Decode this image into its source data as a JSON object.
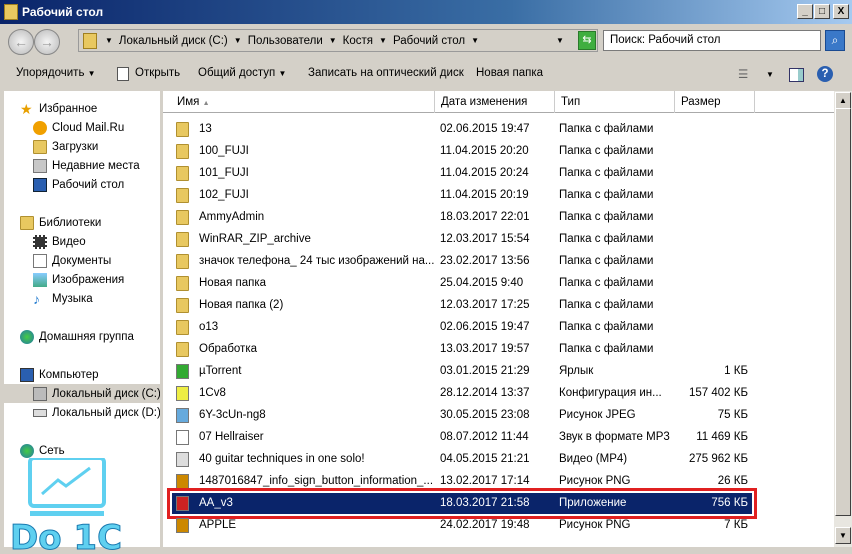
{
  "window": {
    "title": "Рабочий стол",
    "minimize": "_",
    "maximize": "□",
    "close": "X"
  },
  "address": {
    "crumbs": [
      "Локальный диск (C:)",
      "Пользователи",
      "Костя",
      "Рабочий стол"
    ],
    "search_placeholder": "Поиск: Рабочий стол"
  },
  "toolbar": {
    "organize": "Упорядочить",
    "open": "Открыть",
    "share": "Общий доступ",
    "burn": "Записать на оптический диск",
    "new_folder": "Новая папка"
  },
  "sidebar": {
    "favorites": "Избранное",
    "fav_items": [
      "Cloud Mail.Ru",
      "Загрузки",
      "Недавние места",
      "Рабочий стол"
    ],
    "libraries": "Библиотеки",
    "lib_items": [
      "Видео",
      "Документы",
      "Изображения",
      "Музыка"
    ],
    "homegroup": "Домашняя группа",
    "computer": "Компьютер",
    "comp_items": [
      "Локальный диск (C:)",
      "Локальный диск (D:)"
    ],
    "network": "Сеть"
  },
  "columns": {
    "name": "Имя",
    "date": "Дата изменения",
    "type": "Тип",
    "size": "Размер"
  },
  "files": [
    {
      "name": "13",
      "date": "02.06.2015 19:47",
      "type": "Папка с файлами",
      "size": "",
      "icon": "folder"
    },
    {
      "name": "100_FUJI",
      "date": "11.04.2015 20:20",
      "type": "Папка с файлами",
      "size": "",
      "icon": "folder"
    },
    {
      "name": "101_FUJI",
      "date": "11.04.2015 20:24",
      "type": "Папка с файлами",
      "size": "",
      "icon": "folder"
    },
    {
      "name": "102_FUJI",
      "date": "11.04.2015 20:19",
      "type": "Папка с файлами",
      "size": "",
      "icon": "folder"
    },
    {
      "name": "AmmyAdmin",
      "date": "18.03.2017 22:01",
      "type": "Папка с файлами",
      "size": "",
      "icon": "folder"
    },
    {
      "name": "WinRAR_ZIP_archive",
      "date": "12.03.2017 15:54",
      "type": "Папка с файлами",
      "size": "",
      "icon": "folder"
    },
    {
      "name": "значок телефона_ 24 тыс изображений на...",
      "date": "23.02.2017 13:56",
      "type": "Папка с файлами",
      "size": "",
      "icon": "folder"
    },
    {
      "name": "Новая папка",
      "date": "25.04.2015 9:40",
      "type": "Папка с файлами",
      "size": "",
      "icon": "folder"
    },
    {
      "name": "Новая папка (2)",
      "date": "12.03.2017 17:25",
      "type": "Папка с файлами",
      "size": "",
      "icon": "folder"
    },
    {
      "name": "o13",
      "date": "02.06.2015 19:47",
      "type": "Папка с файлами",
      "size": "",
      "icon": "folder"
    },
    {
      "name": "Обработка",
      "date": "13.03.2017 19:57",
      "type": "Папка с файлами",
      "size": "",
      "icon": "folder"
    },
    {
      "name": "µTorrent",
      "date": "03.01.2015 21:29",
      "type": "Ярлык",
      "size": "1 КБ",
      "icon": "shortcut"
    },
    {
      "name": "1Cv8",
      "date": "28.12.2014 13:37",
      "type": "Конфигурация ин...",
      "size": "157 402 КБ",
      "icon": "config"
    },
    {
      "name": "6Y-3cUn-ng8",
      "date": "30.05.2015 23:08",
      "type": "Рисунок JPEG",
      "size": "75 КБ",
      "icon": "image"
    },
    {
      "name": "07 Hellraiser",
      "date": "08.07.2012 11:44",
      "type": "Звук в формате MP3",
      "size": "11 469 КБ",
      "icon": "audio"
    },
    {
      "name": "40 guitar techniques in one solo!",
      "date": "04.05.2015 21:21",
      "type": "Видео (MP4)",
      "size": "275 962 КБ",
      "icon": "video"
    },
    {
      "name": "1487016847_info_sign_button_information_...",
      "date": "13.02.2017 17:14",
      "type": "Рисунок PNG",
      "size": "26 КБ",
      "icon": "png"
    },
    {
      "name": "AA_v3",
      "date": "18.03.2017 21:58",
      "type": "Приложение",
      "size": "756 КБ",
      "icon": "app",
      "selected": true
    },
    {
      "name": "APPLE",
      "date": "24.02.2017 19:48",
      "type": "Рисунок PNG",
      "size": "7 КБ",
      "icon": "png"
    }
  ],
  "watermark": "Do 1C"
}
